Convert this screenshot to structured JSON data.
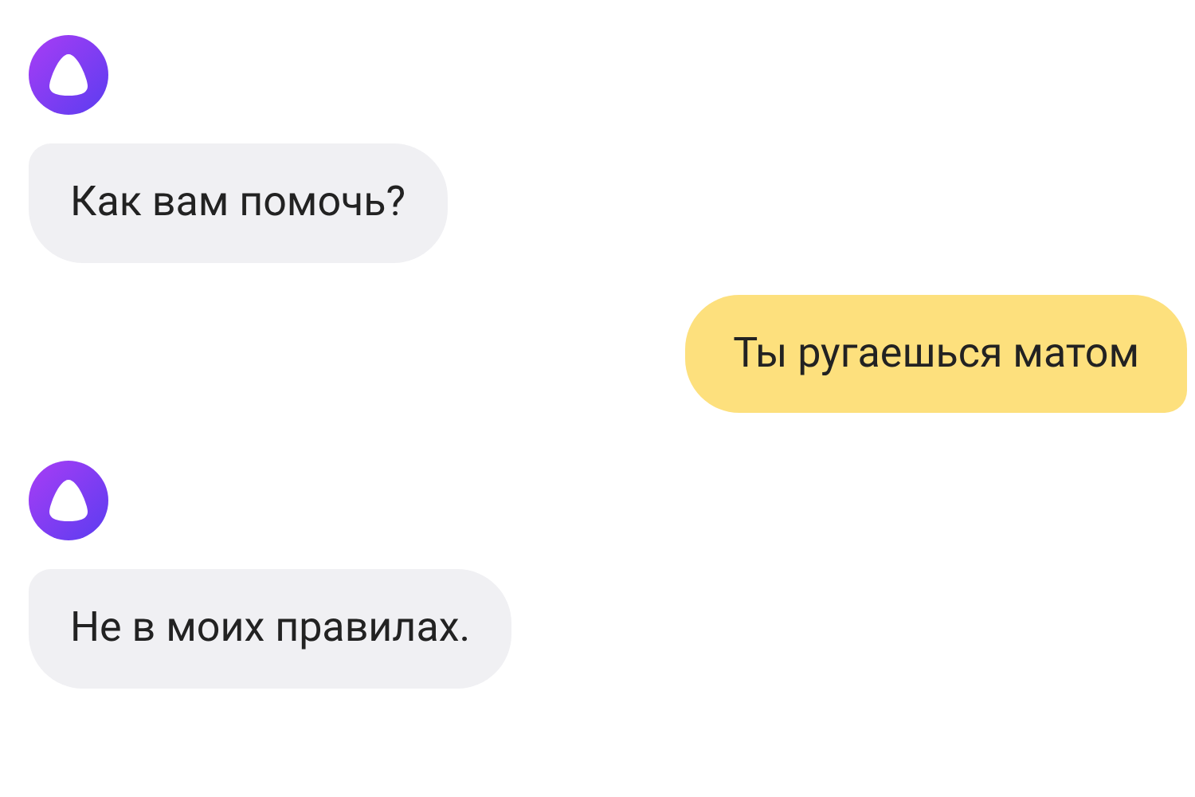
{
  "messages": [
    {
      "kind": "assistant",
      "text": "Как вам помочь?"
    },
    {
      "kind": "user",
      "text": "Ты ругаешься матом"
    },
    {
      "kind": "assistant",
      "text": "Не в моих правилах."
    }
  ]
}
